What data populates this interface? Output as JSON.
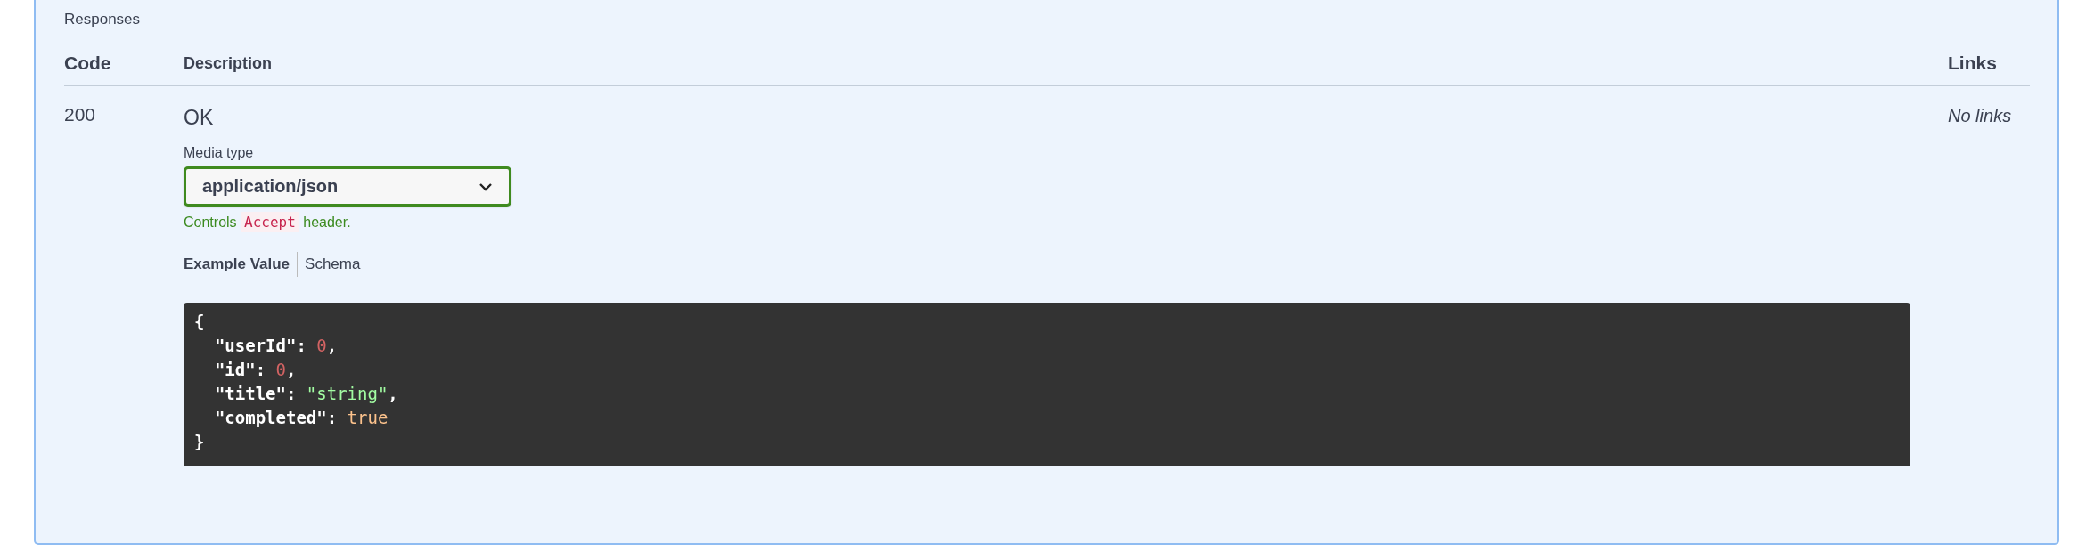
{
  "section_title": "Responses",
  "columns": [
    "Code",
    "Description",
    "Links"
  ],
  "responses": [
    {
      "code": "200",
      "description": "OK",
      "links": "No links",
      "media_type": {
        "label": "Media type",
        "value": "application/json"
      },
      "hint": {
        "before": "Controls",
        "code": "Accept",
        "after": "header."
      },
      "tabs": [
        {
          "label": "Example Value",
          "selected": true
        },
        {
          "label": "Schema",
          "selected": false
        }
      ],
      "example_lines": [
        [
          {
            "kind": "punct",
            "text": "{"
          }
        ],
        [
          {
            "kind": "key",
            "text": "  \"userId\""
          },
          {
            "kind": "punct",
            "text": ": "
          },
          {
            "kind": "number",
            "text": "0"
          },
          {
            "kind": "punct",
            "text": ","
          }
        ],
        [
          {
            "kind": "key",
            "text": "  \"id\""
          },
          {
            "kind": "punct",
            "text": ": "
          },
          {
            "kind": "number",
            "text": "0"
          },
          {
            "kind": "punct",
            "text": ","
          }
        ],
        [
          {
            "kind": "key",
            "text": "  \"title\""
          },
          {
            "kind": "punct",
            "text": ": "
          },
          {
            "kind": "string",
            "text": "\"string\""
          },
          {
            "kind": "punct",
            "text": ","
          }
        ],
        [
          {
            "kind": "key",
            "text": "  \"completed\""
          },
          {
            "kind": "punct",
            "text": ": "
          },
          {
            "kind": "boolean",
            "text": "true"
          }
        ],
        [
          {
            "kind": "punct",
            "text": "}"
          }
        ]
      ]
    }
  ]
}
